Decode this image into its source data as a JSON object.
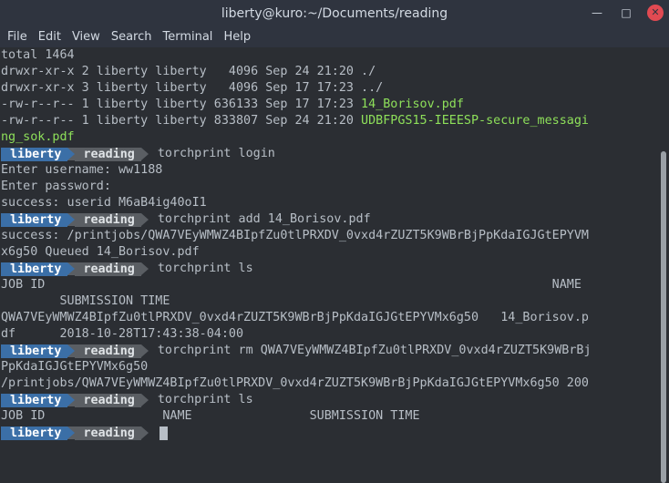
{
  "window": {
    "title": "liberty@kuro:~/Documents/reading"
  },
  "window_buttons": {
    "minimize": "—",
    "maximize": "□",
    "close": "✕"
  },
  "menu": [
    "File",
    "Edit",
    "View",
    "Search",
    "Terminal",
    "Help"
  ],
  "prompt": {
    "user": "liberty",
    "dir": "reading"
  },
  "lines": [
    {
      "type": "text",
      "text": "total 1464"
    },
    {
      "type": "text",
      "text": "drwxr-xr-x 2 liberty liberty   4096 Sep 24 21:20 ./"
    },
    {
      "type": "text",
      "text": "drwxr-xr-x 3 liberty liberty   4096 Sep 17 17:23 ../"
    },
    {
      "type": "file",
      "text": "-rw-r--r-- 1 liberty liberty 636133 Sep 17 17:23 ",
      "name": "14_Borisov.pdf"
    },
    {
      "type": "file",
      "text": "-rw-r--r-- 1 liberty liberty 833807 Sep 24 21:20 ",
      "name": "UDBFPGS15-IEEESP-secure_messagi"
    },
    {
      "type": "green",
      "text": "ng_sok.pdf"
    },
    {
      "type": "prompt",
      "cmd": "torchprint login"
    },
    {
      "type": "text",
      "text": "Enter username: ww1188"
    },
    {
      "type": "text",
      "text": "Enter password:"
    },
    {
      "type": "text",
      "text": "success: userid M6aB4ig40oI1"
    },
    {
      "type": "prompt",
      "cmd": "torchprint add 14_Borisov.pdf"
    },
    {
      "type": "text",
      "text": "success: /printjobs/QWA7VEyWMWZ4BIpfZu0tlPRXDV_0vxd4rZUZT5K9WBrBjPpKdaIGJGtEPYVM"
    },
    {
      "type": "text",
      "text": "x6g50 Queued 14_Borisov.pdf"
    },
    {
      "type": "prompt",
      "cmd": "torchprint ls"
    },
    {
      "type": "text",
      "text": "JOB ID                                                                     NAME"
    },
    {
      "type": "text",
      "text": "        SUBMISSION TIME"
    },
    {
      "type": "text",
      "text": "QWA7VEyWMWZ4BIpfZu0tlPRXDV_0vxd4rZUZT5K9WBrBjPpKdaIGJGtEPYVMx6g50   14_Borisov.p"
    },
    {
      "type": "text",
      "text": "df      2018-10-28T17:43:38-04:00"
    },
    {
      "type": "prompt",
      "cmd": "torchprint rm QWA7VEyWMWZ4BIpfZu0tlPRXDV_0vxd4rZUZT5K9WBrBj"
    },
    {
      "type": "text",
      "text": "PpKdaIGJGtEPYVMx6g50"
    },
    {
      "type": "text",
      "text": "/printjobs/QWA7VEyWMWZ4BIpfZu0tlPRXDV_0vxd4rZUZT5K9WBrBjPpKdaIGJGtEPYVMx6g50 200"
    },
    {
      "type": "prompt",
      "cmd": "torchprint ls"
    },
    {
      "type": "text",
      "text": "JOB ID                NAME                SUBMISSION TIME"
    },
    {
      "type": "prompt_cursor",
      "cmd": ""
    }
  ],
  "colors": {
    "background": "#2b2e33",
    "text": "#b7bec6",
    "green": "#8ee05a",
    "prompt_user_bg": "#3b6fa7",
    "prompt_dir_bg": "#5a5e63"
  }
}
